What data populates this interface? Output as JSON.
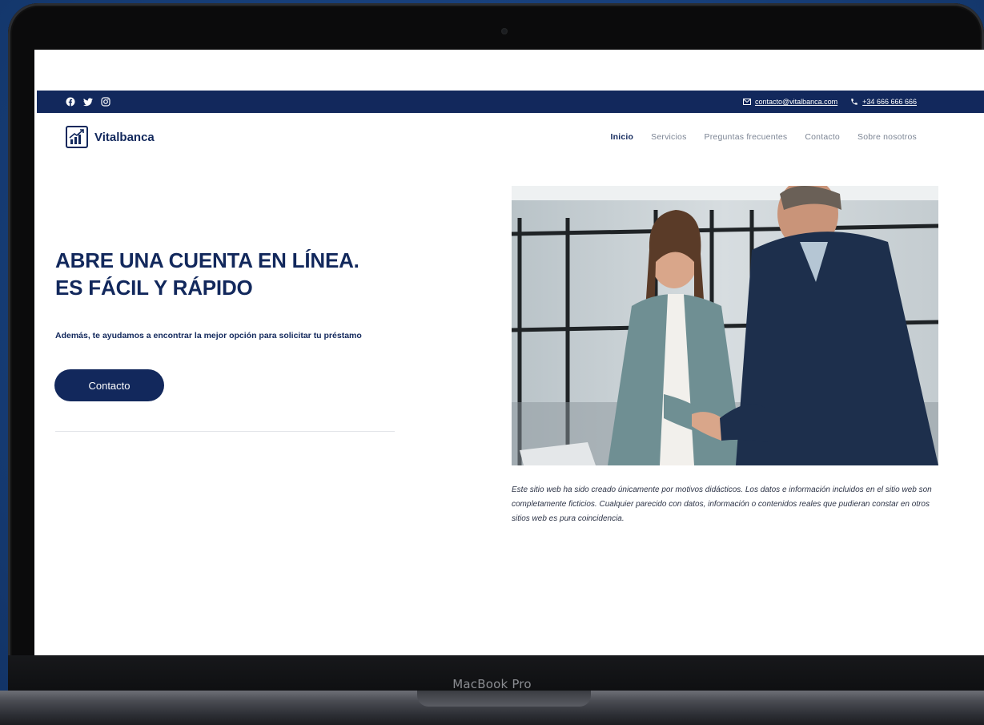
{
  "device": {
    "label": "MacBook Pro"
  },
  "topbar": {
    "social_icons": [
      "facebook-icon",
      "twitter-icon",
      "instagram-icon"
    ],
    "email": "contacto@vitalbanca.com",
    "phone": "+34 666 666 666"
  },
  "header": {
    "brand": "Vitalbanca",
    "nav": [
      "Inicio",
      "Servicios",
      "Preguntas frecuentes",
      "Contacto",
      "Sobre nosotros"
    ],
    "active": "Inicio"
  },
  "hero": {
    "title_line1": "ABRE UNA CUENTA EN LÍNEA.",
    "title_line2": "ES FÁCIL Y RÁPIDO",
    "subtitle": "Además, te ayudamos a encontrar la mejor opción para solicitar tu préstamo",
    "button": "Contacto"
  },
  "disclaimer": "Este sitio web ha sido creado únicamente por motivos didácticos. Los datos e información incluidos en el sitio web son completamente ficticios. Cualquier parecido con datos, información o contenidos reales que pudieran constar en otros sitios web es pura coincidencia.",
  "colors": {
    "primary": "#12285c",
    "background": "#173f7a",
    "nav_text": "#7c8594"
  }
}
